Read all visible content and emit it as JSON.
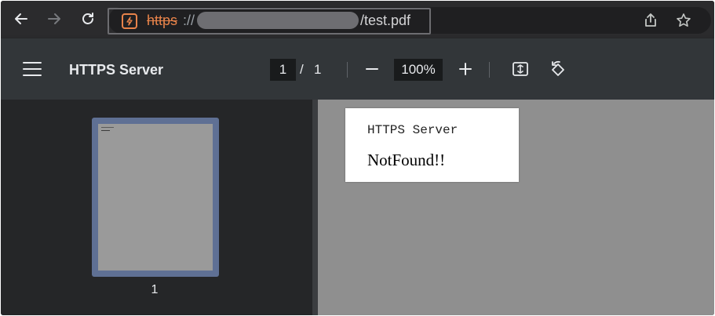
{
  "browser": {
    "url_scheme": "https",
    "url_separator": "://",
    "url_path": "/test.pdf",
    "icons": [
      "back-arrow-icon",
      "forward-arrow-icon",
      "reload-icon",
      "not-secure-icon",
      "share-icon",
      "star-icon"
    ]
  },
  "toolbar": {
    "title": "HTTPS Server",
    "page_current": "1",
    "page_separator": "/",
    "page_total": "1",
    "zoom": "100%"
  },
  "sidebar": {
    "thumbnails": [
      {
        "label": "1"
      }
    ]
  },
  "document": {
    "heading": "HTTPS Server",
    "body": "NotFound!!"
  },
  "colors": {
    "accent_warning": "#e8834a",
    "thumbnail_selected": "#5f7094",
    "viewer_background": "#8f8f8f"
  }
}
